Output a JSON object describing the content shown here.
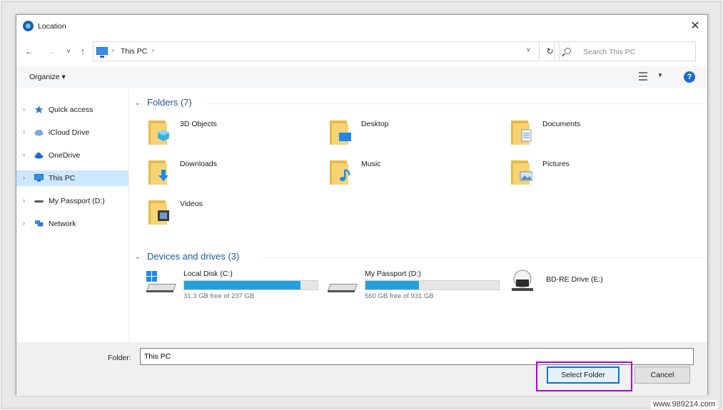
{
  "window": {
    "title": "Location",
    "close_glyph": "✕"
  },
  "nav": {
    "back_glyph": "←",
    "forward_glyph": "→",
    "recent_glyph": "˅",
    "up_glyph": "↑",
    "breadcrumb": [
      "This PC"
    ],
    "address_dropdown_glyph": "˅",
    "refresh_glyph": "↻"
  },
  "search": {
    "placeholder": "Search This PC"
  },
  "toolbar": {
    "organize_label": "Organize ▾",
    "view_caret": "▼",
    "help_glyph": "?"
  },
  "sidebar": {
    "items": [
      {
        "label": "Quick access",
        "icon": "star-icon",
        "selected": false
      },
      {
        "label": "iCloud Drive",
        "icon": "cloud-icon",
        "selected": false
      },
      {
        "label": "OneDrive",
        "icon": "onedrive-icon",
        "selected": false
      },
      {
        "label": "This PC",
        "icon": "pc-icon",
        "selected": true
      },
      {
        "label": "My Passport (D:)",
        "icon": "drive-icon",
        "selected": false
      },
      {
        "label": "Network",
        "icon": "network-icon",
        "selected": false
      }
    ]
  },
  "groups": {
    "folders_title": "Folders (7)",
    "drives_title": "Devices and drives (3)"
  },
  "folders": [
    {
      "label": "3D Objects",
      "badge": "cube-icon"
    },
    {
      "label": "Desktop",
      "badge": "desktop-icon"
    },
    {
      "label": "Documents",
      "badge": "document-icon"
    },
    {
      "label": "Downloads",
      "badge": "download-arrow-icon"
    },
    {
      "label": "Music",
      "badge": "music-note-icon"
    },
    {
      "label": "Pictures",
      "badge": "picture-icon"
    },
    {
      "label": "Videos",
      "badge": "film-icon"
    }
  ],
  "drives": [
    {
      "name": "Local Disk (C:)",
      "free_text": "31.3 GB free of 237 GB",
      "used_fraction": 0.87,
      "icon": "windows-drive-icon"
    },
    {
      "name": "My Passport (D:)",
      "free_text": "560 GB free of 931 GB",
      "used_fraction": 0.4,
      "icon": "external-drive-icon"
    },
    {
      "name": "BD-RE Drive (E:)",
      "free_text": "",
      "used_fraction": null,
      "icon": "bluray-drive-icon"
    }
  ],
  "footer": {
    "folder_label": "Folder:",
    "folder_value": "This PC",
    "select_button": "Select Folder",
    "cancel_button": "Cancel"
  },
  "watermark": "www.989214.com",
  "colors": {
    "accent": "#0078d7",
    "selection": "#cce8ff",
    "drive_fill": "#26a0da",
    "highlight": "#a800e6",
    "group_title": "#1e5aa0"
  }
}
